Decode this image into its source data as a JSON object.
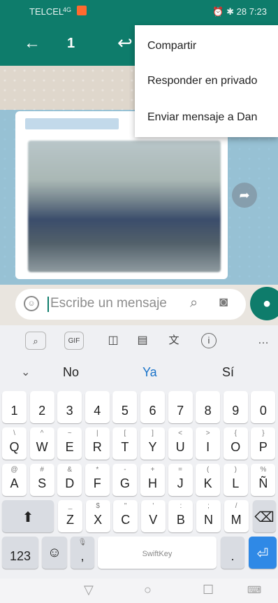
{
  "status_bar": {
    "carrier": "TELCEL",
    "signal": "4G",
    "battery": "28",
    "time": "7:23"
  },
  "app_bar": {
    "back_icon": "arrow-left-icon",
    "selected_count": "1",
    "reply_icon": "reply-icon"
  },
  "menu": {
    "items": [
      "Compartir",
      "Responder en privado",
      "Enviar mensaje a Dan"
    ]
  },
  "input": {
    "placeholder": "Escribe un mensaje"
  },
  "keyboard": {
    "toolbar": [
      "GIF"
    ],
    "suggestions": [
      "No",
      "Ya",
      "Sí"
    ],
    "rows": {
      "numbers": [
        "1",
        "2",
        "3",
        "4",
        "5",
        "6",
        "7",
        "8",
        "9",
        "0"
      ],
      "row1": [
        [
          "Q",
          "\\"
        ],
        [
          "W",
          "^"
        ],
        [
          "E",
          "~"
        ],
        [
          "R",
          "|"
        ],
        [
          "T",
          "["
        ],
        [
          "Y",
          "]"
        ],
        [
          "U",
          "<"
        ],
        [
          "I",
          ">"
        ],
        [
          "O",
          "{"
        ],
        [
          "P",
          "}"
        ]
      ],
      "row2": [
        [
          "A",
          "@"
        ],
        [
          "S",
          "#"
        ],
        [
          "D",
          "&"
        ],
        [
          "F",
          "*"
        ],
        [
          "G",
          "-"
        ],
        [
          "H",
          "+"
        ],
        [
          "J",
          "="
        ],
        [
          "K",
          "("
        ],
        [
          "L",
          ")"
        ],
        [
          "Ñ",
          "%"
        ]
      ],
      "row3": [
        [
          "Z",
          "_"
        ],
        [
          "X",
          "$"
        ],
        [
          "C",
          "\""
        ],
        [
          "V",
          "'"
        ],
        [
          "B",
          ":"
        ],
        [
          "N",
          ";"
        ],
        [
          "M",
          "/"
        ]
      ]
    },
    "bottom": {
      "numbers_key": "123",
      "period": ".",
      "comma": ",",
      "brand": "SwiftKey"
    }
  },
  "colors": {
    "accent": "#0e7c6b",
    "suggest_active": "#1a73c9",
    "enter_key": "#2f89e6"
  }
}
